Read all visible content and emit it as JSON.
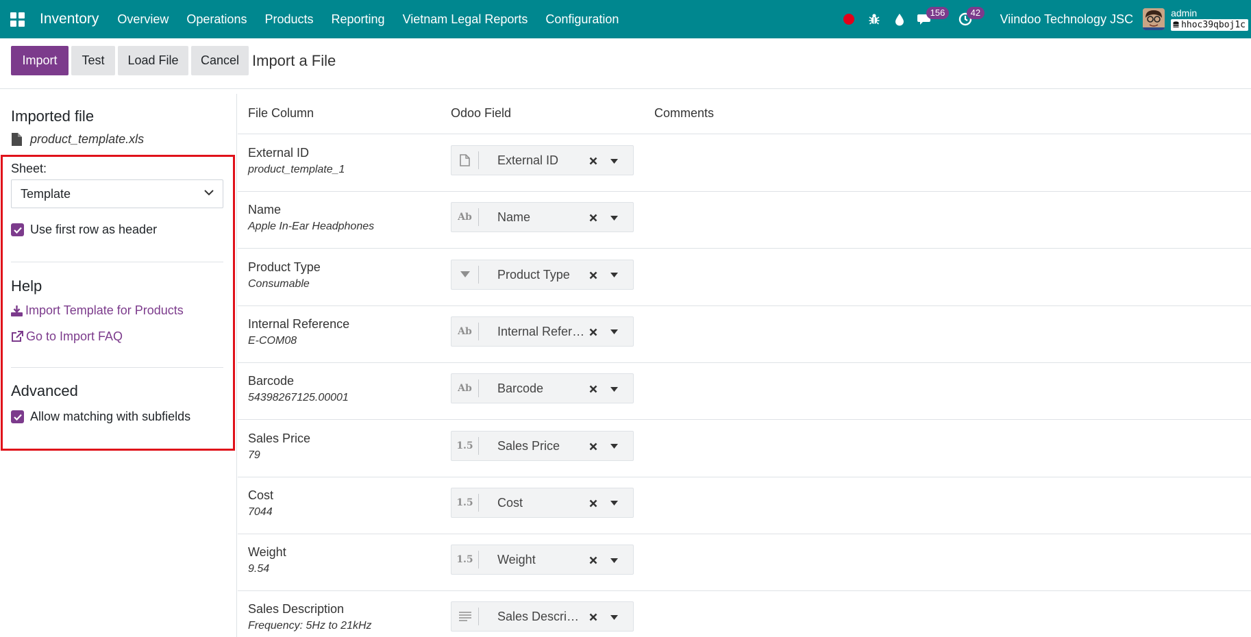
{
  "navbar": {
    "app_name": "Inventory",
    "menu": [
      "Overview",
      "Operations",
      "Products",
      "Reporting",
      "Vietnam Legal Reports",
      "Configuration"
    ],
    "messages_count": "156",
    "activities_count": "42",
    "company": "Viindoo Technology JSC",
    "user_name": "admin",
    "database": "hhoc39qboj1c",
    "record_color": "#e2001a",
    "bar_color": "#00878f"
  },
  "control_panel": {
    "import_label": "Import",
    "test_label": "Test",
    "load_file_label": "Load File",
    "cancel_label": "Cancel",
    "title": "Import a File"
  },
  "left_panel": {
    "imported_file_title": "Imported file",
    "file_name": "product_template.xls",
    "sheet_label": "Sheet:",
    "sheet_value": "Template",
    "use_first_row_label": "Use first row as header",
    "use_first_row_checked": true,
    "help_title": "Help",
    "help_links": [
      "Import Template for Products",
      "Go to Import FAQ"
    ],
    "advanced_title": "Advanced",
    "allow_subfields_label": "Allow matching with subfields",
    "allow_subfields_checked": true
  },
  "table": {
    "headers": {
      "file_column": "File Column",
      "odoo_field": "Odoo Field",
      "comments": "Comments"
    },
    "rows": [
      {
        "column": "External ID",
        "sample": "product_template_1",
        "field": "External ID",
        "field_type_icon": "file-icon"
      },
      {
        "column": "Name",
        "sample": "Apple In-Ear Headphones",
        "field": "Name",
        "field_type_icon": "text-type-icon",
        "type_glyph": "Ab"
      },
      {
        "column": "Product Type",
        "sample": "Consumable",
        "field": "Product Type",
        "field_type_icon": "selection-type-icon"
      },
      {
        "column": "Internal Reference",
        "sample": "E-COM08",
        "field": "Internal Reference",
        "field_type_icon": "text-type-icon",
        "type_glyph": "Ab"
      },
      {
        "column": "Barcode",
        "sample": "54398267125.00001",
        "field": "Barcode",
        "field_type_icon": "text-type-icon",
        "type_glyph": "Ab"
      },
      {
        "column": "Sales Price",
        "sample": "79",
        "field": "Sales Price",
        "field_type_icon": "float-type-icon",
        "type_glyph": "1.5"
      },
      {
        "column": "Cost",
        "sample": "7044",
        "field": "Cost",
        "field_type_icon": "float-type-icon",
        "type_glyph": "1.5"
      },
      {
        "column": "Weight",
        "sample": "9.54",
        "field": "Weight",
        "field_type_icon": "float-type-icon",
        "type_glyph": "1.5"
      },
      {
        "column": "Sales Description",
        "sample": "Frequency: 5Hz to 21kHz",
        "field": "Sales Description",
        "field_type_icon": "html-type-icon"
      }
    ]
  }
}
